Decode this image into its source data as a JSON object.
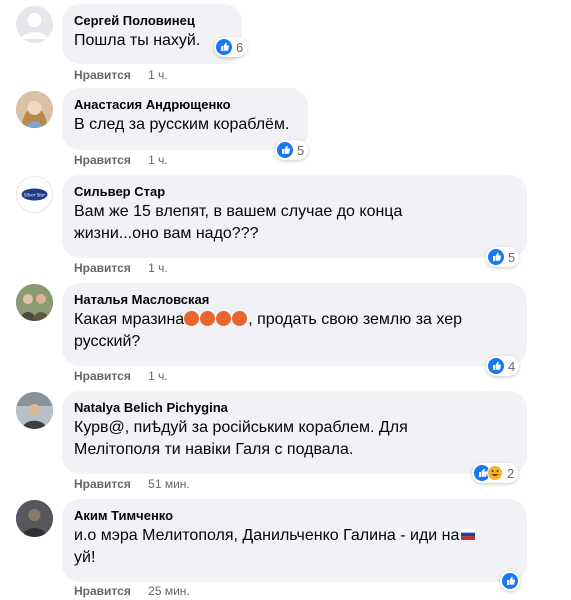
{
  "comments": [
    {
      "author": "Сергей Половинец",
      "text": "Пошла ты нахуй.",
      "like_label": "Нравится",
      "time": "1 ч.",
      "reactions": "6",
      "avatar": "default-avatar-icon"
    },
    {
      "author": "Анастасия Андрющенко",
      "text": "В след за русским кораблём.",
      "like_label": "Нравится",
      "time": "1 ч.",
      "reactions": "5",
      "avatar": "user-photo-avatar"
    },
    {
      "author": "Сильвер Стар",
      "text_line1": "Вам же 15 влепят, в вашем случае до конца",
      "text_line2": "жизни...оно вам надо???",
      "like_label": "Нравится",
      "time": "1 ч.",
      "reactions": "5",
      "avatar": "logo-avatar"
    },
    {
      "author": "Наталья Масловская",
      "text_line1a": "Какая мразина",
      "text_line1b": ", продать свою землю за хер",
      "text_line2": "русский?",
      "like_label": "Нравится",
      "time": "1 ч.",
      "reactions": "4",
      "avatar": "user-photo-avatar"
    },
    {
      "author": "Natalya Belich Pichygina",
      "text_line1": "Курв@, пиѣдуй за російським кораблем. Для",
      "text_line2": "Мелітополя ти навіки Галя с подвала.",
      "like_label": "Нравится",
      "time": "51 мин.",
      "reactions": "2",
      "avatar": "user-photo-avatar"
    },
    {
      "author": "Аким Тимченко",
      "text_line1": "и.о мэра Мелитополя, Данильченко Галина - иди на",
      "text_line2": "уй!",
      "like_label": "Нравится",
      "time": "25 мин.",
      "reactions": "",
      "avatar": "user-photo-avatar"
    }
  ],
  "colors": {
    "bubble": "#f0f2f5",
    "like_blue": "#1877f2",
    "meta_gray": "#65676b"
  }
}
